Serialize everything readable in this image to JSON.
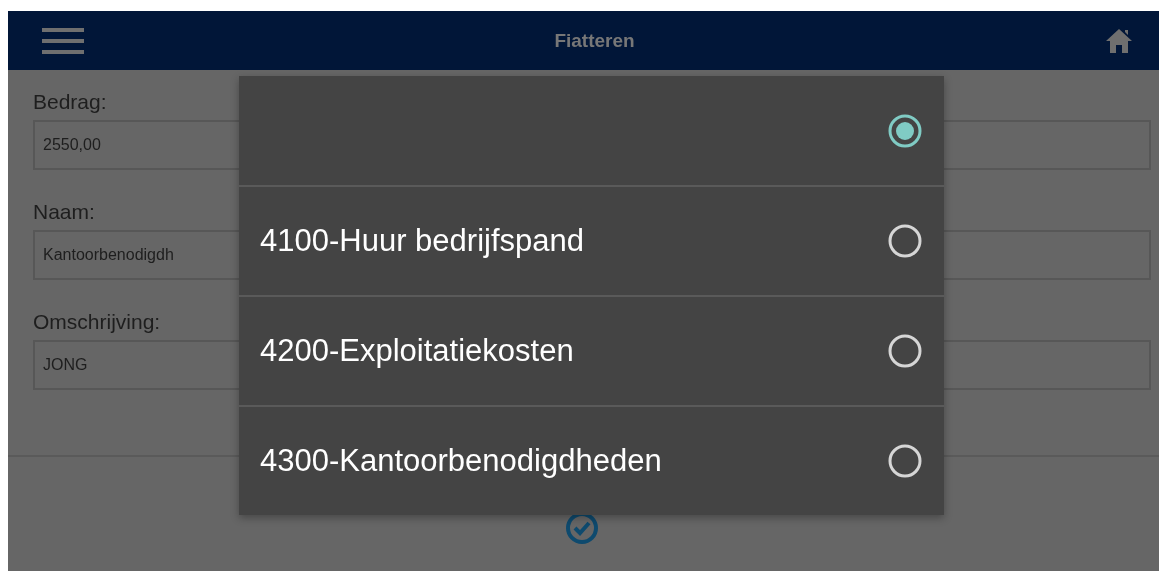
{
  "header": {
    "title": "Fiatteren"
  },
  "fields": [
    {
      "label": "Bedrag:",
      "value": "2550,00"
    },
    {
      "label": "Naam:",
      "value": "Kantoorbenodigdh"
    },
    {
      "label": "Omschrijving:",
      "value": "JONG"
    }
  ],
  "dialog": {
    "options": [
      {
        "selected": true
      },
      {
        "label": "4100-Huur bedrijfspand",
        "selected": false
      },
      {
        "label": "4200-Exploitatiekosten",
        "selected": false
      },
      {
        "label": "4300-Kantoorbenodigdheden",
        "selected": false
      }
    ]
  }
}
